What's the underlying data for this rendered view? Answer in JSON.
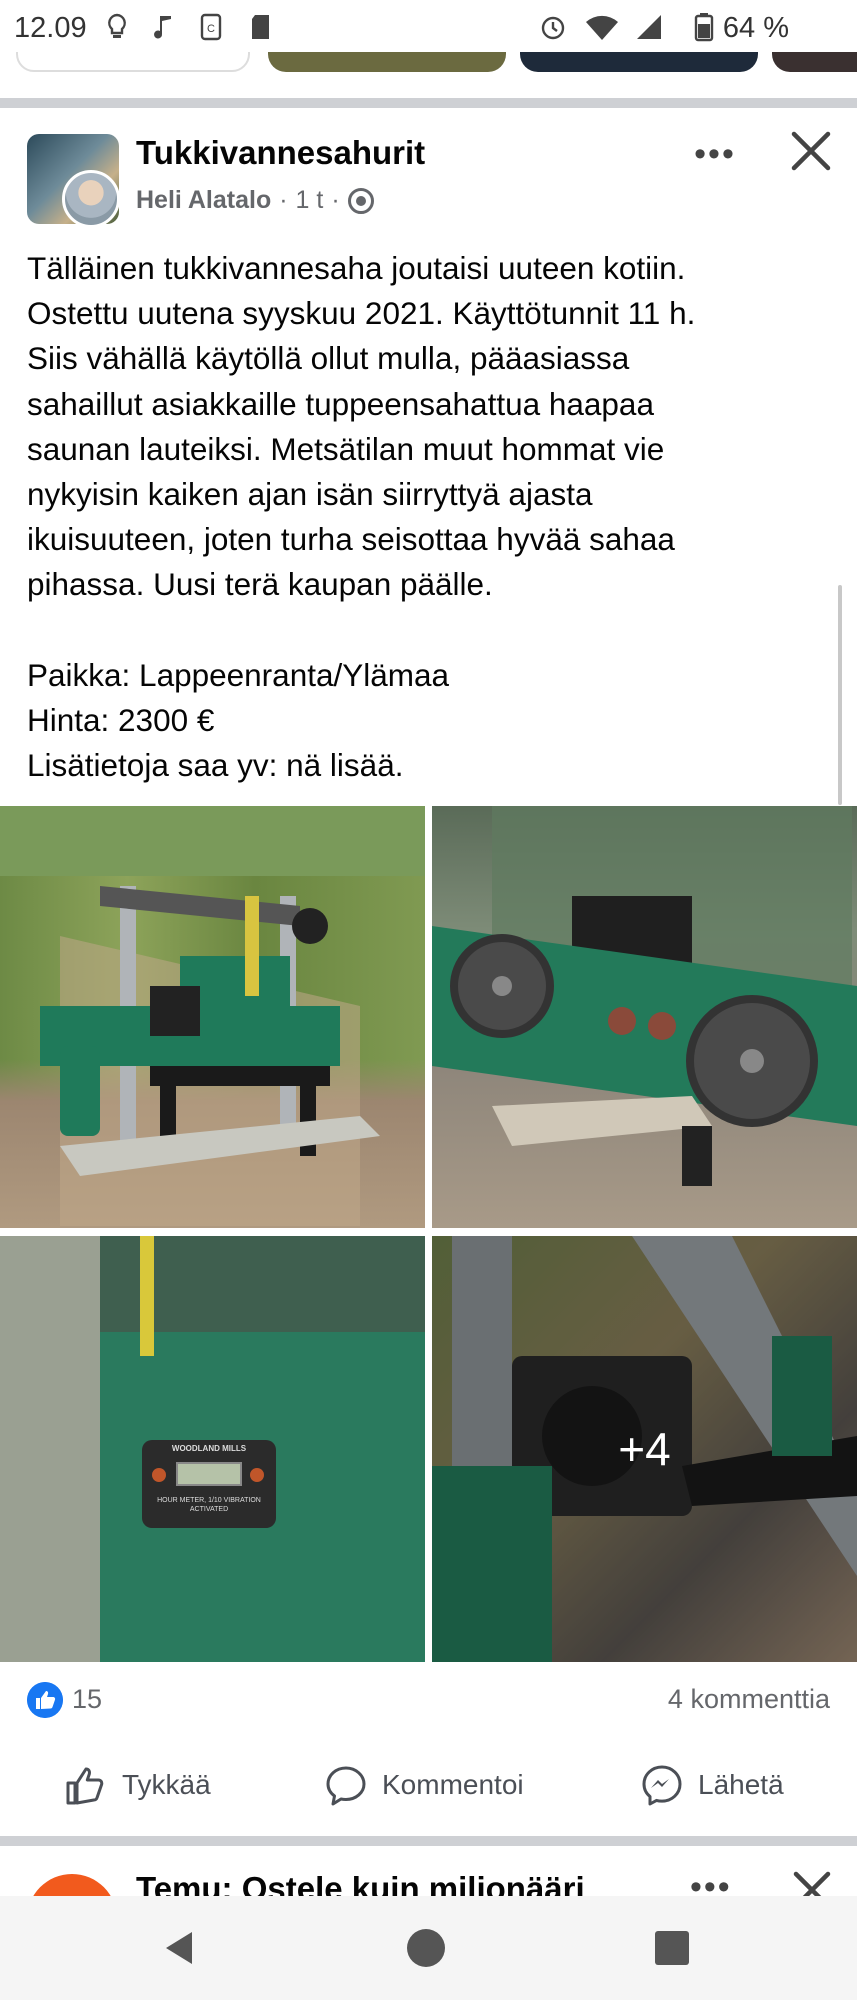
{
  "status_bar": {
    "time": "12.09",
    "battery": "64 %"
  },
  "post": {
    "group_name": "Tukkivannesahurit",
    "author": "Heli Alatalo",
    "time_ago": "1 t",
    "separator": "·",
    "more_label": "•••",
    "text_lines": [
      "Tälläinen tukkivannesaha joutaisi uuteen kotiin.",
      "Ostettu uutena syyskuu 2021. Käyttötunnit 11 h.",
      "Siis vähällä käytöllä ollut mulla, pääasiassa",
      "sahaillut asiakkaille tuppeensahattua haapaa",
      "saunan lauteiksi. Metsätilan muut hommat vie",
      "nykyisin kaiken ajan isän siirryttyä ajasta",
      "ikuisuuteen, joten turha seisottaa hyvää sahaa",
      "pihassa. Uusi terä kaupan päälle."
    ],
    "details": [
      "Paikka: Lappeenranta/Ylämaa",
      "Hinta: 2300 €",
      "Lisätietoja saa yv: nä lisää."
    ],
    "photos": {
      "more_count": "+4",
      "hour_meter_brand": "WOODLAND MILLS",
      "hour_meter_caption": "HOUR METER, 1/10 VIBRATION ACTIVATED"
    },
    "like_count": "15",
    "comment_count": "4 kommenttia",
    "actions": {
      "like": "Tykkää",
      "comment": "Kommentoi",
      "send": "Lähetä"
    }
  },
  "next_post": {
    "title": "Temu: Ostele kuin miljonääri",
    "more_label": "•••"
  },
  "colors": {
    "like_blue": "#1877f2",
    "divider": "#ced0d4",
    "meta_gray": "#65676b"
  }
}
